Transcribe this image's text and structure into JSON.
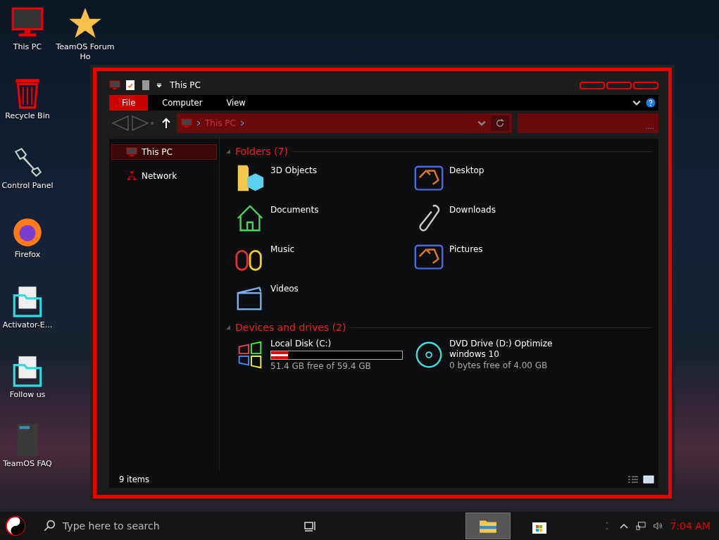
{
  "desktop_icons": [
    {
      "label": "This PC"
    },
    {
      "label": "TeamOS Forum Ho"
    },
    {
      "label": "Recycle Bin"
    },
    {
      "label": "Control Panel"
    },
    {
      "label": "Firefox"
    },
    {
      "label": "Activator-E..."
    },
    {
      "label": "Follow us"
    },
    {
      "label": "TeamOS FAQ"
    }
  ],
  "window": {
    "title": "This PC"
  },
  "ribbon_tabs": [
    {
      "label": "File",
      "selected": true
    },
    {
      "label": "Computer",
      "selected": false
    },
    {
      "label": "View",
      "selected": false
    }
  ],
  "address": {
    "path": "This PC"
  },
  "search": {
    "value": "...."
  },
  "nav_pane": [
    {
      "label": "This PC",
      "selected": true
    },
    {
      "label": "Network",
      "selected": false
    }
  ],
  "folders": {
    "title": "Folders (7)",
    "items": [
      {
        "label": "3D Objects"
      },
      {
        "label": "Desktop"
      },
      {
        "label": "Documents"
      },
      {
        "label": "Downloads"
      },
      {
        "label": "Music"
      },
      {
        "label": "Pictures"
      },
      {
        "label": "Videos"
      }
    ]
  },
  "devices": {
    "title": "Devices and drives (2)",
    "items": [
      {
        "label": "Local Disk (C:)",
        "level": 0.13,
        "free": "51.4 GB free of 59.4 GB"
      },
      {
        "label": "DVD Drive (D:) Optimize windows 10",
        "free": "0 bytes free of 4.00 GB"
      }
    ]
  },
  "status_bar": {
    "count": "9 items"
  },
  "taskbar": {
    "search_placeholder": "Type here to search",
    "time": "7:04 AM"
  }
}
